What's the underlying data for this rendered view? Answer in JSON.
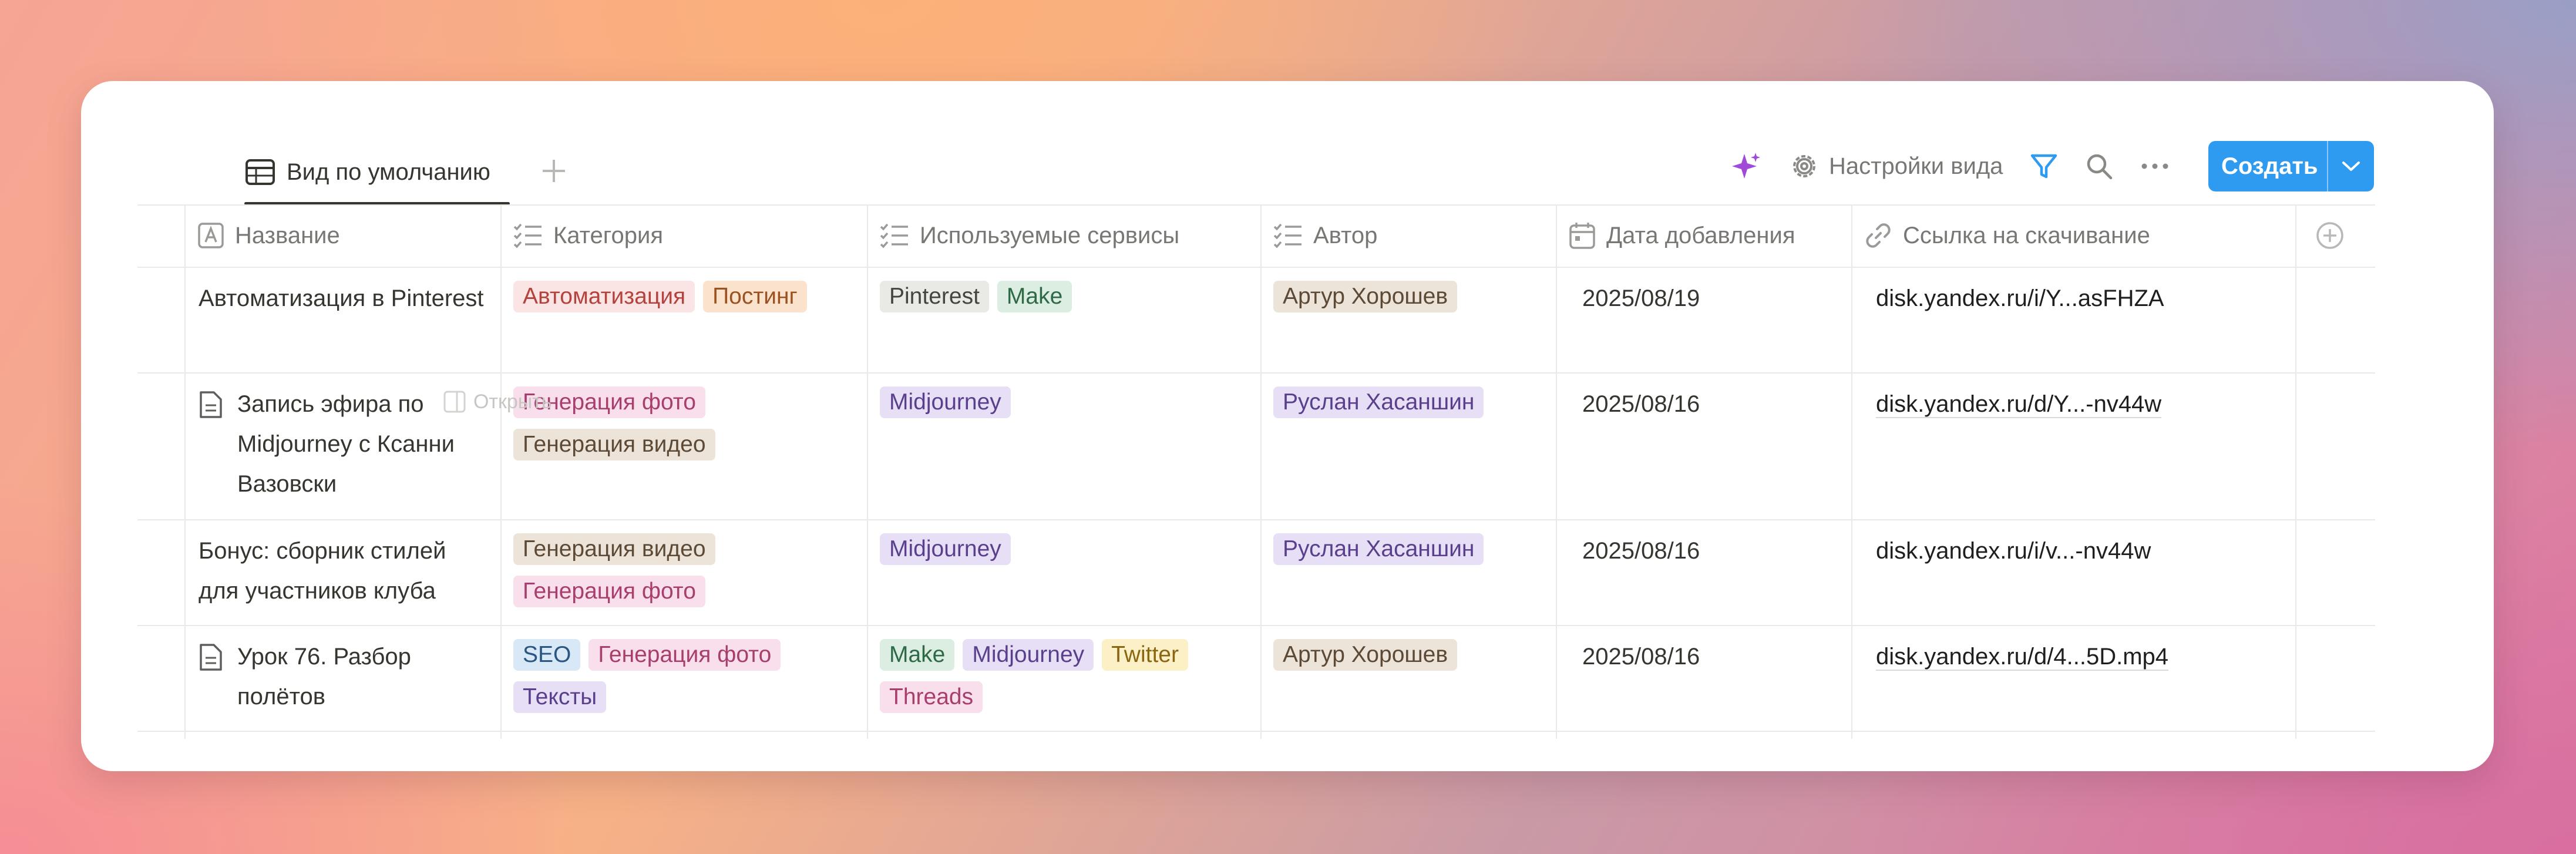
{
  "toolbar": {
    "view_tab_label": "Вид по умолчанию",
    "view_settings_label": "Настройки вида",
    "create_label": "Создать"
  },
  "table": {
    "columns": [
      {
        "label": "Название",
        "icon": "text-icon"
      },
      {
        "label": "Категория",
        "icon": "multi-select-icon"
      },
      {
        "label": "Используемые сервисы",
        "icon": "multi-select-icon"
      },
      {
        "label": "Автор",
        "icon": "multi-select-icon"
      },
      {
        "label": "Дата добавления",
        "icon": "calendar-icon"
      },
      {
        "label": "Ссылка на скачивание",
        "icon": "link-icon"
      }
    ],
    "hover_open_label": "Открыть",
    "rows": [
      {
        "title": "Автоматизация в Pinterest",
        "has_page_icon": false,
        "categories": [
          {
            "label": "Автоматизация",
            "color": "red"
          },
          {
            "label": "Постинг",
            "color": "orange"
          }
        ],
        "services": [
          {
            "label": "Pinterest",
            "color": "gray"
          },
          {
            "label": "Make",
            "color": "green"
          }
        ],
        "author": {
          "label": "Артур Хорошев",
          "color": "brown"
        },
        "date": "2025/08/19",
        "link": "disk.yandex.ru/i/Y...asFHZA"
      },
      {
        "title": "Запись эфира по Midjourney с Ксанни Вазовски",
        "has_page_icon": true,
        "categories": [
          {
            "label": "Генерация фото",
            "color": "pink"
          },
          {
            "label": "Генерация видео",
            "color": "brown"
          }
        ],
        "services": [
          {
            "label": "Midjourney",
            "color": "purple"
          }
        ],
        "author": {
          "label": "Руслан Хасаншин",
          "color": "purple"
        },
        "date": "2025/08/16",
        "link": "disk.yandex.ru/d/Y...-nv44w"
      },
      {
        "title": "Бонус: сборник стилей для участников клуба",
        "has_page_icon": false,
        "categories": [
          {
            "label": "Генерация видео",
            "color": "brown"
          },
          {
            "label": "Генерация фото",
            "color": "pink"
          }
        ],
        "services": [
          {
            "label": "Midjourney",
            "color": "purple"
          }
        ],
        "author": {
          "label": "Руслан Хасаншин",
          "color": "purple"
        },
        "date": "2025/08/16",
        "link": "disk.yandex.ru/i/v...-nv44w"
      },
      {
        "title": "Урок 76. Разбор полётов",
        "has_page_icon": true,
        "categories": [
          {
            "label": "SEO",
            "color": "blue"
          },
          {
            "label": "Генерация фото",
            "color": "pink"
          },
          {
            "label": "Тексты",
            "color": "purple"
          }
        ],
        "services": [
          {
            "label": "Make",
            "color": "green"
          },
          {
            "label": "Midjourney",
            "color": "purple"
          },
          {
            "label": "Twitter",
            "color": "yellow"
          },
          {
            "label": "Threads",
            "color": "pink"
          }
        ],
        "author": {
          "label": "Артур Хорошев",
          "color": "brown"
        },
        "date": "2025/08/16",
        "link": "disk.yandex.ru/d/4...5D.mp4"
      }
    ]
  },
  "tag_colors": {
    "red": {
      "bg": "#fbe4e4",
      "fg": "#b4433e"
    },
    "orange": {
      "bg": "#fbe2cc",
      "fg": "#9a5220"
    },
    "gray": {
      "bg": "#e9e9e6",
      "fg": "#454441"
    },
    "green": {
      "bg": "#dceee2",
      "fg": "#2f6a47"
    },
    "brown": {
      "bg": "#ece4d8",
      "fg": "#5c4a37"
    },
    "pink": {
      "bg": "#f8dfeb",
      "fg": "#a73e6e"
    },
    "purple": {
      "bg": "#e6dff5",
      "fg": "#5a3f8d"
    },
    "blue": {
      "bg": "#d9e8f7",
      "fg": "#2a5782"
    },
    "yellow": {
      "bg": "#fbf0c6",
      "fg": "#8a6512"
    }
  },
  "accent_color": "#2f9bf0"
}
